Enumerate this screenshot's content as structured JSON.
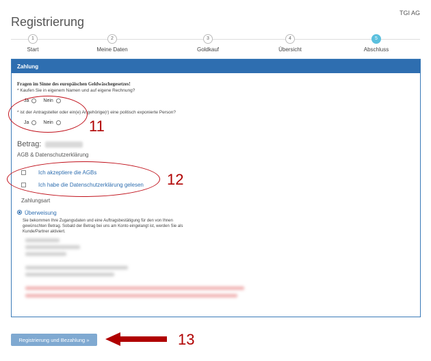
{
  "company": "TGI AG",
  "title": "Registrierung",
  "steps": [
    {
      "num": "1",
      "label": "Start"
    },
    {
      "num": "2",
      "label": "Meine Daten"
    },
    {
      "num": "3",
      "label": "Goldkauf"
    },
    {
      "num": "4",
      "label": "Übersicht"
    },
    {
      "num": "5",
      "label": "Abschluss"
    }
  ],
  "active_step": 5,
  "panel": {
    "heading": "Zahlung",
    "section_title": "Fragen im Sinne des europäischen Geldwäschegesetzes!",
    "q1": "* Kaufen Sie in eigenem Namen und auf eigene Rechnung?",
    "q2": "* ist der Antragsteller oder ein(e) Angehörige(r) eine politisch exponierte Person?",
    "yes": "Ja",
    "no": "Nein",
    "betrag_label": "Betrag:",
    "agb_title": "AGB & Datenschutzerklärung",
    "agb_check": "Ich akzeptiere die AGBs",
    "privacy_check": "Ich habe die Datenschutzerklärung gelesen",
    "zahlungsart": "Zahlungsart",
    "ueberweisung": "Überweisung",
    "ueberweisung_desc": "Sie bekommen Ihre Zugangsdaten und eine Auftragsbestätigung für den von Ihnen gewünschten Betrag. Sobald der Betrag bei uns am Konto eingelangt ist, werden Sie als Kunde/Partner aktiviert."
  },
  "submit_label": "Registrierung und Bezahlung »",
  "annotations": {
    "a11": "11",
    "a12": "12",
    "a13": "13"
  },
  "colors": {
    "primary": "#2e6eb0",
    "active_step": "#5bc0de",
    "annotation": "#c0101a"
  }
}
